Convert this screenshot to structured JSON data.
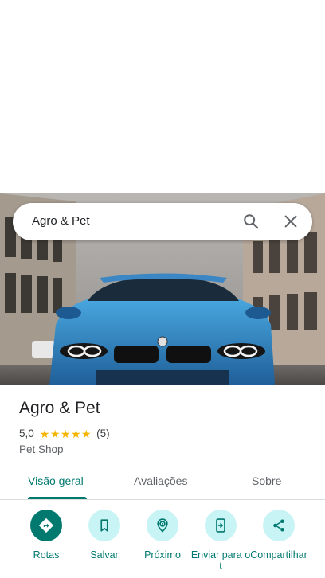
{
  "search": {
    "query": "Agro & Pet"
  },
  "place": {
    "name": "Agro & Pet",
    "rating": "5,0",
    "stars": [
      "★",
      "★",
      "★",
      "★",
      "★"
    ],
    "review_count": "(5)",
    "category": "Pet Shop"
  },
  "tabs": [
    {
      "label": "Visão geral"
    },
    {
      "label": "Avaliações"
    },
    {
      "label": "Sobre"
    }
  ],
  "actions": [
    {
      "label": "Rotas",
      "icon": "directions-icon"
    },
    {
      "label": "Salvar",
      "icon": "bookmark-icon"
    },
    {
      "label": "Próximo",
      "icon": "nearby-icon"
    },
    {
      "label": "Enviar para o t",
      "icon": "send-to-phone-icon"
    },
    {
      "label": "Compartilhar",
      "icon": "share-icon"
    }
  ],
  "colors": {
    "accent": "#01796f",
    "action_bg": "#c8f4f6",
    "star": "#f4b400"
  }
}
